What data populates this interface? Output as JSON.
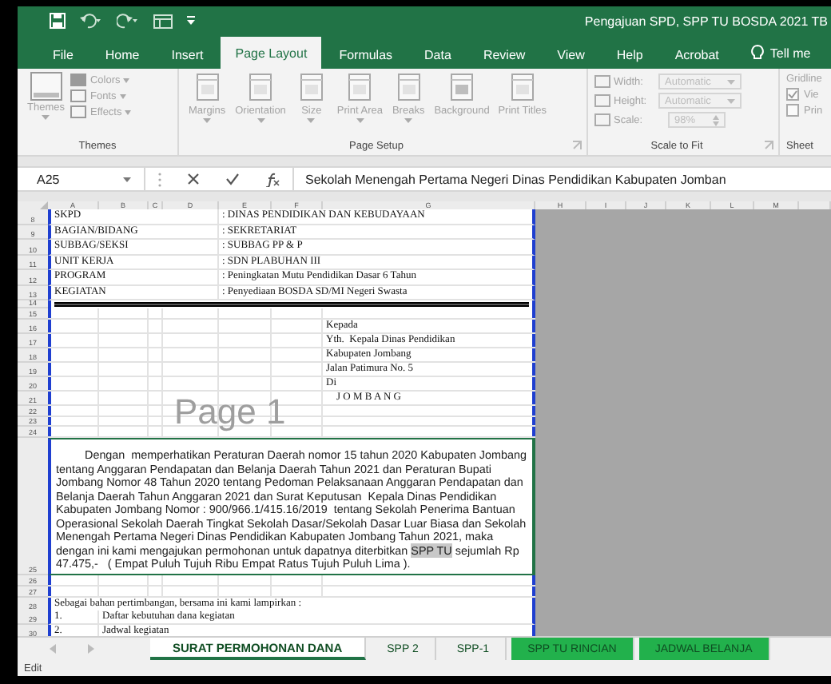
{
  "title_bar": {
    "title": "Pengajuan SPD, SPP TU BOSDA 2021 TB"
  },
  "ribbon_tabs": [
    {
      "label": "File",
      "selected": false
    },
    {
      "label": "Home",
      "selected": false
    },
    {
      "label": "Insert",
      "selected": false
    },
    {
      "label": "Page Layout",
      "selected": true
    },
    {
      "label": "Formulas",
      "selected": false
    },
    {
      "label": "Data",
      "selected": false
    },
    {
      "label": "Review",
      "selected": false
    },
    {
      "label": "View",
      "selected": false
    },
    {
      "label": "Help",
      "selected": false
    },
    {
      "label": "Acrobat",
      "selected": false
    }
  ],
  "tell_me": "Tell me",
  "ribbon": {
    "themes": {
      "label": "Themes",
      "button": "Themes",
      "options": [
        "Colors",
        "Fonts",
        "Effects"
      ]
    },
    "page_setup": {
      "label": "Page Setup",
      "buttons": [
        {
          "label": "Margins",
          "dropdown": true
        },
        {
          "label": "Orientation",
          "dropdown": true
        },
        {
          "label": "Size",
          "dropdown": true
        },
        {
          "label": "Print Area",
          "dropdown": true
        },
        {
          "label": "Breaks",
          "dropdown": true
        },
        {
          "label": "Background",
          "dropdown": false
        },
        {
          "label": "Print Titles",
          "dropdown": false
        }
      ]
    },
    "scale_to_fit": {
      "label": "Scale to Fit",
      "fields": [
        {
          "label": "Width:",
          "value": "Automatic",
          "kind": "dropdown"
        },
        {
          "label": "Height:",
          "value": "Automatic",
          "kind": "dropdown"
        },
        {
          "label": "Scale:",
          "value": "98%",
          "kind": "spinner"
        }
      ]
    },
    "sheet_options": {
      "label": "Sheet",
      "heading": "Gridline",
      "options": [
        {
          "label": "Vie",
          "checked": true
        },
        {
          "label": "Prin",
          "checked": false
        }
      ]
    }
  },
  "formula_bar": {
    "name_box": "A25",
    "formula": "Sekolah Menengah Pertama Negeri Dinas Pendidikan Kabupaten Jomban"
  },
  "columns": [
    "A",
    "B",
    "C",
    "D",
    "E",
    "F",
    "G",
    "H",
    "I",
    "J",
    "K",
    "L",
    "M"
  ],
  "page_marker": "Page 1",
  "rows": [
    {
      "number": "8",
      "kind": "field",
      "label": "SKPD",
      "value": ": DINAS PENDIDIKAN DAN KEBUDAYAAN"
    },
    {
      "number": "9",
      "kind": "field",
      "label": "BAGIAN/BIDANG",
      "value": ": SEKRETARIAT"
    },
    {
      "number": "10",
      "kind": "field",
      "label": "SUBBAG/SEKSI",
      "value": ": SUBBAG PP & P"
    },
    {
      "number": "11",
      "kind": "field",
      "label": "UNIT KERJA",
      "value": ": SDN PLABUHAN III"
    },
    {
      "number": "12",
      "kind": "field",
      "label": "PROGRAM",
      "value": ": Peningkatan Mutu Pendidikan Dasar 6 Tahun"
    },
    {
      "number": "13",
      "kind": "field",
      "label": "KEGIATAN",
      "value": ": Penyediaan BOSDA SD/MI Negeri Swasta"
    },
    {
      "number": "14",
      "kind": "divider"
    },
    {
      "number": "15",
      "kind": "blank"
    },
    {
      "number": "16",
      "kind": "address",
      "text": "Kepada"
    },
    {
      "number": "17",
      "kind": "address",
      "text": "Yth.  Kepala Dinas Pendidikan"
    },
    {
      "number": "18",
      "kind": "address",
      "text": "Kabupaten Jombang"
    },
    {
      "number": "19",
      "kind": "address",
      "text": "Jalan Patimura No. 5"
    },
    {
      "number": "20",
      "kind": "address",
      "text": "Di"
    },
    {
      "number": "21",
      "kind": "address",
      "text": "    J O M B A N G"
    },
    {
      "number": "22",
      "kind": "blank"
    },
    {
      "number": "23",
      "kind": "blank"
    },
    {
      "number": "24",
      "kind": "blank"
    },
    {
      "number": "25",
      "kind": "paragraph",
      "parts": [
        {
          "text": "Dengan  memperhatikan Peraturan Daerah nomor 15 tahun 2020 Kabupaten Jombang tentang Anggaran Pendapatan dan Belanja Daerah Tahun 2021 dan Peraturan Bupati Jombang Nomor 48 Tahun 2020 tentang Pedoman Pelaksanaan Anggaran Pendapatan dan Belanja Daerah Tahun Anggaran 2021 dan Surat Keputusan  Kepala Dinas Pendidikan Kabupaten Jombang Nomor : 900/966.1/415.16/2019  tentang Sekolah Penerima Bantuan Operasional Sekolah Daerah Tingkat Sekolah Dasar/Sekolah Dasar Luar Biasa dan Sekolah Menengah Pertama Negeri Dinas Pendidikan Kabupaten Jombang Tahun 2021, maka dengan ini kami mengajukan permohonan untuk dapatnya diterbitkan ",
          "highlighted": false
        },
        {
          "text": "SPP TU",
          "highlighted": true
        },
        {
          "text": " sejumlah Rp 47.475,-   ( Empat Puluh Tujuh Ribu Empat Ratus Tujuh Puluh Lima ).",
          "highlighted": false
        }
      ]
    },
    {
      "number": "26",
      "kind": "blank"
    },
    {
      "number": "27",
      "kind": "blank"
    },
    {
      "number": "28",
      "kind": "note",
      "text": "Sebagai bahan pertimbangan, bersama ini kami lampirkan :"
    },
    {
      "number": "29",
      "kind": "list",
      "index": "1.",
      "text": "Daftar kebutuhan dana kegiatan"
    },
    {
      "number": "30",
      "kind": "list",
      "index": "2.",
      "text": "Jadwal kegiatan"
    }
  ],
  "sheet_tabs": [
    {
      "label": "SURAT PERMOHONAN DANA",
      "selected": true
    },
    {
      "label": "SPP 2",
      "selected": false
    },
    {
      "label": "SPP-1",
      "selected": false
    },
    {
      "label": "SPP TU RINCIAN",
      "selected": false,
      "color": "#22b14c"
    },
    {
      "label": "JADWAL BELANJA",
      "selected": false,
      "color": "#22b14c"
    }
  ],
  "status_bar": {
    "mode": "Edit"
  }
}
